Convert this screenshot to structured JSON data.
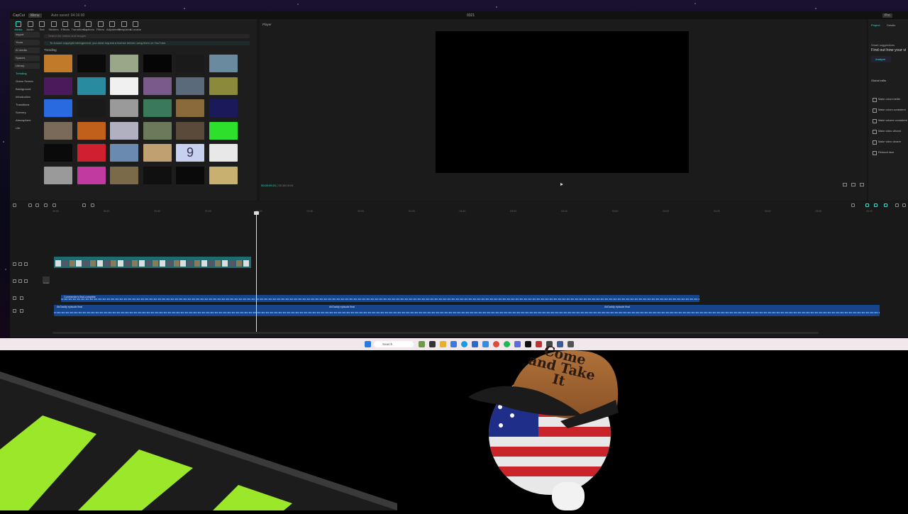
{
  "app": {
    "title_left": "CapCut",
    "menu": "Menu",
    "autosave": "Auto saved: 04:16:00",
    "window_title": "0321",
    "pro_badge": "Pro"
  },
  "media_tabs": [
    {
      "label": "Media"
    },
    {
      "label": "Audio"
    },
    {
      "label": "Text"
    },
    {
      "label": "Stickers"
    },
    {
      "label": "Effects"
    },
    {
      "label": "Transitions"
    },
    {
      "label": "Captions"
    },
    {
      "label": "Filters"
    },
    {
      "label": "Adjustment"
    },
    {
      "label": "Templates"
    },
    {
      "label": "AI avatar"
    }
  ],
  "categories": [
    {
      "label": "Import"
    },
    {
      "label": "Yours"
    },
    {
      "label": "AI media"
    },
    {
      "label": "Spaces"
    },
    {
      "label": "Library"
    },
    {
      "label": "Trending"
    },
    {
      "label": "Green Screen"
    },
    {
      "label": "Background"
    },
    {
      "label": "Introduction"
    },
    {
      "label": "Transitions"
    },
    {
      "label": "Scenery"
    },
    {
      "label": "Atmosphere"
    },
    {
      "label": "Life"
    }
  ],
  "search": {
    "placeholder": "Search for videos and images"
  },
  "banner_text": "To ensure copyright infringement, you must request a license before using them on YouTube.",
  "trending_label": "Trending",
  "thumbnails": [
    {
      "color": "#c07a2a"
    },
    {
      "color": "#0a0a0a"
    },
    {
      "color": "#9aa88a"
    },
    {
      "color": "#050505"
    },
    {
      "color": "#1a1a1a"
    },
    {
      "color": "#6a8aa0"
    },
    {
      "color": "#4a1a5a"
    },
    {
      "color": "#2a8aa0"
    },
    {
      "color": "#f0f0f0"
    },
    {
      "color": "#7a5a8a"
    },
    {
      "color": "#5a6a7a"
    },
    {
      "color": "#8a8a3a"
    },
    {
      "color": "#2a6ae0"
    },
    {
      "color": "#1a1a1a"
    },
    {
      "color": "#9a9a9a"
    },
    {
      "color": "#3a7a5a"
    },
    {
      "color": "#8a6a3a"
    },
    {
      "color": "#1a1a5a"
    },
    {
      "color": "#7a6a5a"
    },
    {
      "color": "#c0601a"
    },
    {
      "color": "#b0b0c0"
    },
    {
      "color": "#6a7a5a"
    },
    {
      "color": "#5a4a3a"
    },
    {
      "color": "#2ee02e"
    },
    {
      "color": "#0a0a0a"
    },
    {
      "color": "#d02030"
    },
    {
      "color": "#6a8ab0"
    },
    {
      "color": "#c0a070"
    },
    {
      "color": "#c8d0f0"
    },
    {
      "color": "#e8e8e8"
    },
    {
      "color": "#9a9a9a"
    },
    {
      "color": "#c03aa0"
    },
    {
      "color": "#7a6a4a"
    },
    {
      "color": "#101010"
    },
    {
      "color": "#0a0a0a"
    },
    {
      "color": "#c8b070"
    }
  ],
  "thumb_text": {
    "digit": "9"
  },
  "player": {
    "title": "Player",
    "time_current": "00:00:09:21",
    "time_total": "00:16:10:01"
  },
  "right_panel": {
    "tab_project": "Project",
    "tab_details": "Details",
    "smart_title": "Smart suggestions",
    "smart_big": "Find out how your vi",
    "analyze": "Analyze",
    "global_edits": "Global edits",
    "edits": [
      {
        "label": "Make colors better"
      },
      {
        "label": "Make colors consistent"
      },
      {
        "label": "Make volume consistent"
      },
      {
        "label": "Make video vibrant"
      },
      {
        "label": "Make video clearer"
      },
      {
        "label": "Retouch face"
      }
    ]
  },
  "timeline": {
    "ruler": [
      "00:00",
      "00:20",
      "00:40",
      "01:00",
      "01:20",
      "01:40",
      "02:00",
      "02:20",
      "02:40",
      "03:00",
      "03:20",
      "03:40",
      "04:00",
      "04:20",
      "04:40",
      "05:00",
      "05:20"
    ],
    "audio1_label": "Commenter's final-complete",
    "audio2_label_a": "AirDaddy episode final",
    "audio2_label_b": "AirDaddy episode final",
    "audio2_label_c": "AirDaddy episode final",
    "cover_label": "Cover"
  },
  "taskbar": {
    "search": "Search"
  },
  "hat_text": "Come and Take It",
  "colors": {
    "accent": "#2ee0d0",
    "clip_track": "#1e6c70",
    "audio_track": "#17458c",
    "stripe_green": "#9be82a"
  }
}
